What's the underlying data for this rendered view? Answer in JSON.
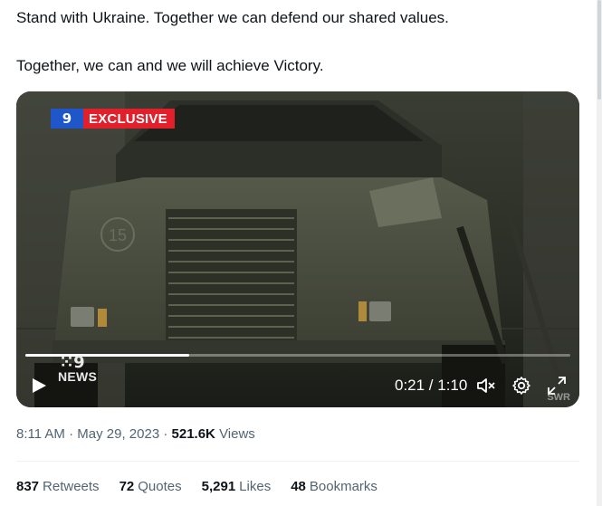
{
  "tweet": {
    "lines": [
      "Stand with Ukraine. Together we can defend our shared values.",
      "Together, we can and we will achieve Victory."
    ]
  },
  "video": {
    "exclusive_logo": "9",
    "exclusive_label": "EXCLUSIVE",
    "news_bug_word": "NEWS",
    "vehicle_number": "15",
    "current_time": "0:21",
    "duration": "1:10",
    "time_display": "0:21 / 1:10",
    "progress_fraction": 0.3,
    "watermark": "SWR",
    "icons": {
      "play": "play-icon",
      "mute": "volume-muted-icon",
      "settings": "gear-icon",
      "fullscreen": "fullscreen-icon"
    },
    "colors": {
      "exclusive_red": "#e2202c",
      "logo_blue": "#1f56c9"
    }
  },
  "meta": {
    "time": "8:11 AM",
    "separator": "·",
    "date": "May 29, 2023",
    "views_count": "521.6K",
    "views_label": "Views"
  },
  "stats": [
    {
      "count": "837",
      "label": "Retweets"
    },
    {
      "count": "72",
      "label": "Quotes"
    },
    {
      "count": "5,291",
      "label": "Likes"
    },
    {
      "count": "48",
      "label": "Bookmarks"
    }
  ]
}
